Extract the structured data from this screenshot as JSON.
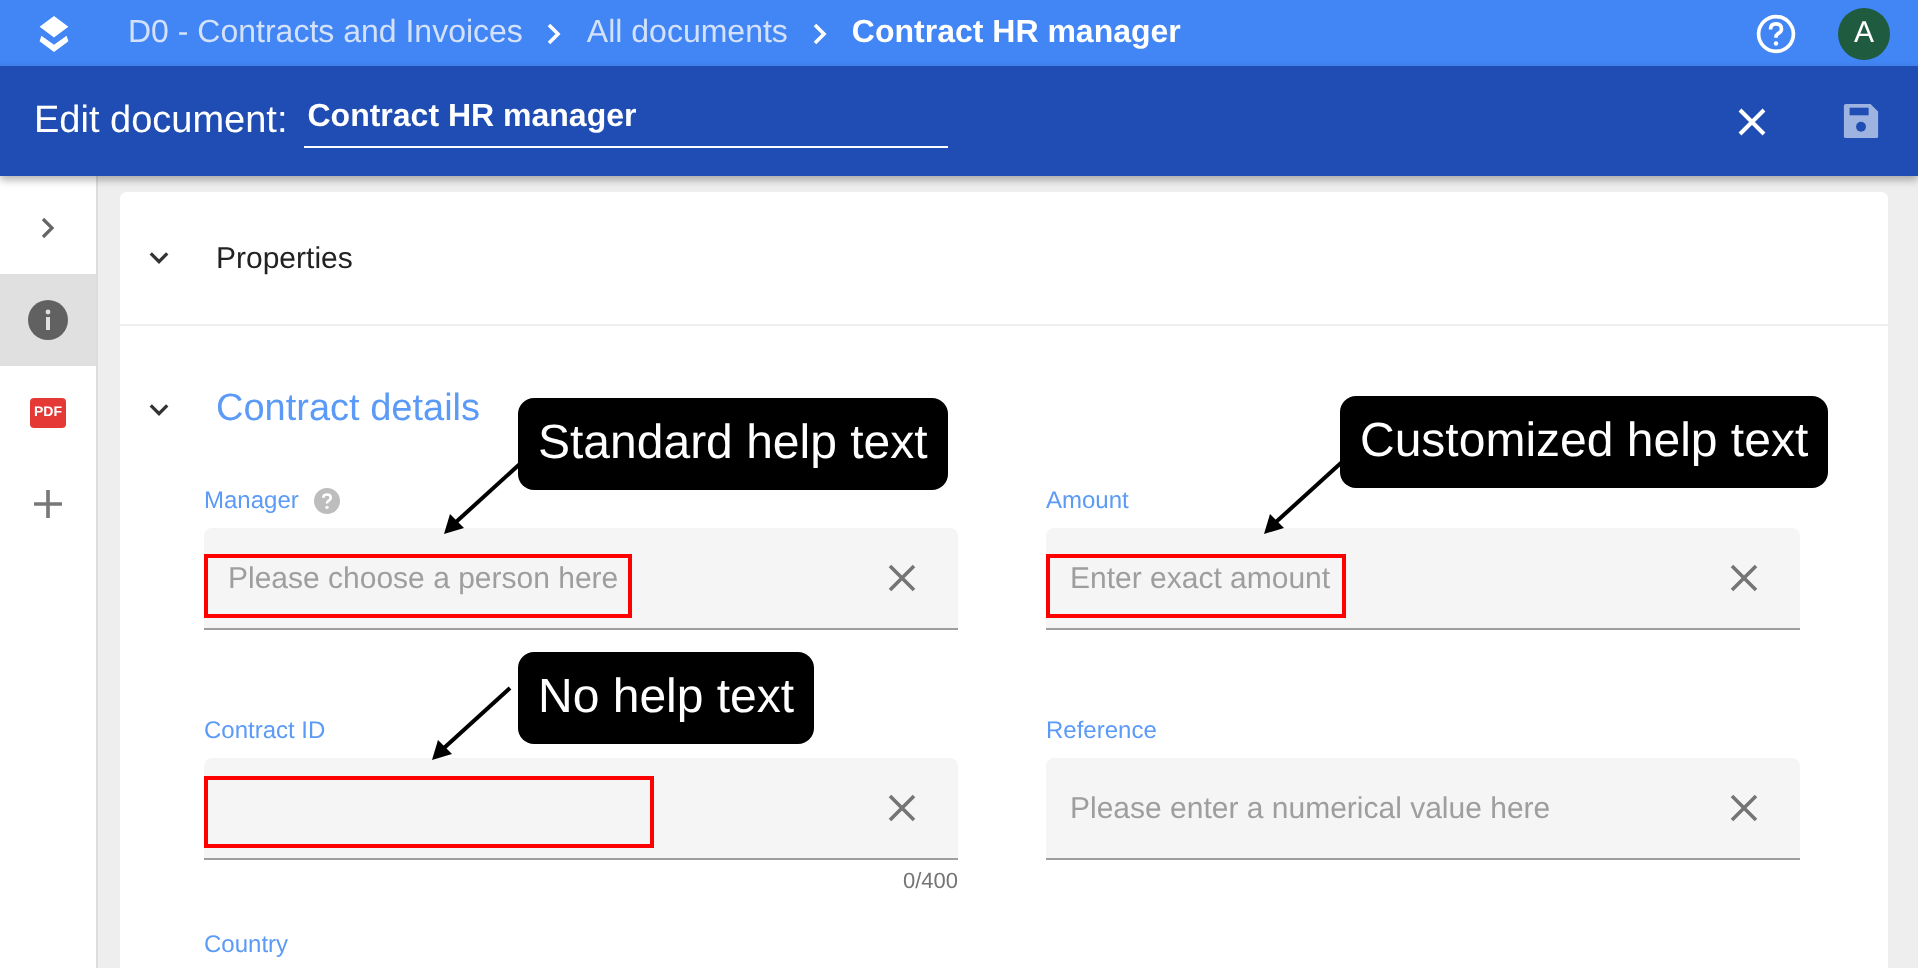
{
  "breadcrumbs": [
    {
      "label": "D0 - Contracts and Invoices",
      "current": false
    },
    {
      "label": "All documents",
      "current": false
    },
    {
      "label": "Contract HR manager",
      "current": true
    }
  ],
  "avatar": {
    "initial": "A"
  },
  "edit_bar": {
    "label": "Edit document:",
    "value": "Contract HR manager"
  },
  "sidebar": {
    "items": [
      {
        "kind": "expand",
        "selected": false
      },
      {
        "kind": "info",
        "selected": true
      },
      {
        "kind": "pdf",
        "selected": false,
        "text": "PDF"
      },
      {
        "kind": "add",
        "selected": false
      }
    ]
  },
  "sections": [
    {
      "title": "Properties",
      "expanded": false
    },
    {
      "title": "Contract details",
      "expanded": true
    }
  ],
  "fields": [
    {
      "label": "Manager",
      "help_icon": true,
      "placeholder": "Please choose a person here",
      "highlighted": true
    },
    {
      "label": "Amount",
      "help_icon": false,
      "placeholder": "Enter exact amount",
      "highlighted": true
    },
    {
      "label": "Contract ID",
      "help_icon": false,
      "highlighted": true,
      "counter": "0/400"
    },
    {
      "label": "Reference",
      "help_icon": false,
      "placeholder": "Please enter a numerical value here",
      "highlighted": false
    }
  ],
  "next_field_label": "Country",
  "callouts": [
    "Standard help text",
    "Customized help text",
    "No help text"
  ]
}
